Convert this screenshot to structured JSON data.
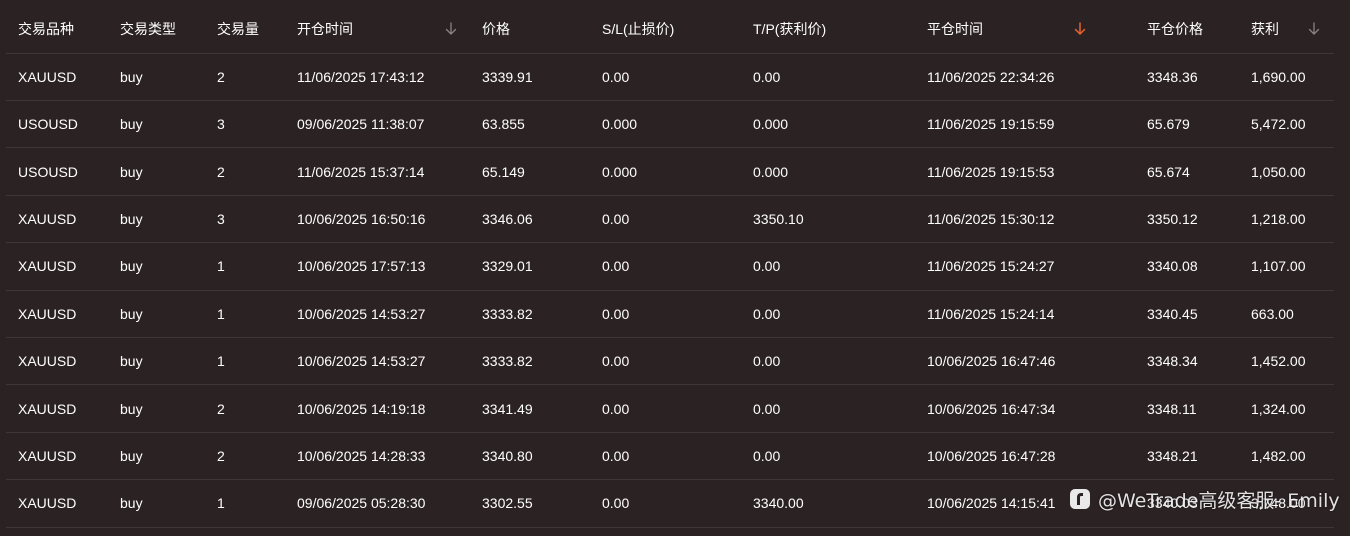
{
  "colors": {
    "background": "#2b2224",
    "divider": "#403537",
    "text": "#ffffff",
    "sort_active": "#e8612c",
    "sort_inactive": "#8a8284"
  },
  "table": {
    "headers": [
      "交易品种",
      "交易类型",
      "交易量",
      "开仓时间",
      "价格",
      "S/L(止损价)",
      "T/P(获利价)",
      "平仓时间",
      "平仓价格",
      "获利"
    ],
    "sort_icons": [
      {
        "column": "open_time",
        "icon": "arrow-down-icon",
        "active": false
      },
      {
        "column": "close_time",
        "icon": "arrow-down-icon",
        "active": true
      },
      {
        "column": "profit",
        "icon": "arrow-down-icon",
        "active": false
      }
    ],
    "rows": [
      [
        "XAUUSD",
        "buy",
        "2",
        "11/06/2025 17:43:12",
        "3339.91",
        "0.00",
        "0.00",
        "11/06/2025 22:34:26",
        "3348.36",
        "1,690.00"
      ],
      [
        "USOUSD",
        "buy",
        "3",
        "09/06/2025 11:38:07",
        "63.855",
        "0.000",
        "0.000",
        "11/06/2025 19:15:59",
        "65.679",
        "5,472.00"
      ],
      [
        "USOUSD",
        "buy",
        "2",
        "11/06/2025 15:37:14",
        "65.149",
        "0.000",
        "0.000",
        "11/06/2025 19:15:53",
        "65.674",
        "1,050.00"
      ],
      [
        "XAUUSD",
        "buy",
        "3",
        "10/06/2025 16:50:16",
        "3346.06",
        "0.00",
        "3350.10",
        "11/06/2025 15:30:12",
        "3350.12",
        "1,218.00"
      ],
      [
        "XAUUSD",
        "buy",
        "1",
        "10/06/2025 17:57:13",
        "3329.01",
        "0.00",
        "0.00",
        "11/06/2025 15:24:27",
        "3340.08",
        "1,107.00"
      ],
      [
        "XAUUSD",
        "buy",
        "1",
        "10/06/2025 14:53:27",
        "3333.82",
        "0.00",
        "0.00",
        "11/06/2025 15:24:14",
        "3340.45",
        "663.00"
      ],
      [
        "XAUUSD",
        "buy",
        "1",
        "10/06/2025 14:53:27",
        "3333.82",
        "0.00",
        "0.00",
        "10/06/2025 16:47:46",
        "3348.34",
        "1,452.00"
      ],
      [
        "XAUUSD",
        "buy",
        "2",
        "10/06/2025 14:19:18",
        "3341.49",
        "0.00",
        "0.00",
        "10/06/2025 16:47:34",
        "3348.11",
        "1,324.00"
      ],
      [
        "XAUUSD",
        "buy",
        "2",
        "10/06/2025 14:28:33",
        "3340.80",
        "0.00",
        "0.00",
        "10/06/2025 16:47:28",
        "3348.21",
        "1,482.00"
      ],
      [
        "XAUUSD",
        "buy",
        "1",
        "09/06/2025 05:28:30",
        "3302.55",
        "0.00",
        "3340.00",
        "10/06/2025 14:15:41",
        "3340.03",
        "3,748.00"
      ]
    ]
  },
  "watermark": {
    "icon": "social-logo-icon",
    "text": "@WeTrade高级客服- Emily"
  }
}
